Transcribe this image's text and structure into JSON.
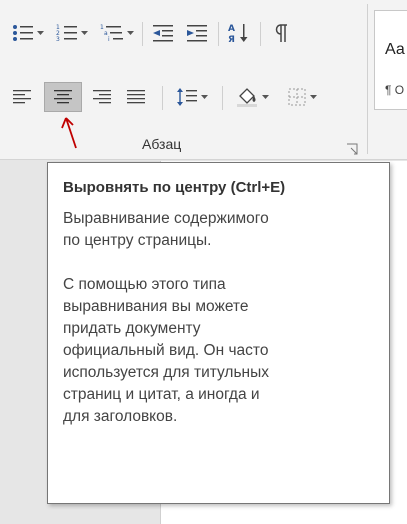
{
  "ribbon": {
    "group_label": "Абзац",
    "styles_sample_text": "Аа",
    "styles_name_text": "¶ О"
  },
  "tooltip": {
    "title": "Выровнять по центру (Ctrl+E)",
    "description_lines": [
      "Выравнивание содержимого",
      "по центру страницы."
    ],
    "details_lines": [
      "С помощью этого типа",
      "выравнивания вы можете",
      "придать документу",
      "официальный вид. Он часто",
      "используется для титульных",
      "страниц и цитат, а иногда и",
      "для заголовков."
    ]
  },
  "colors": {
    "accent_blue": "#2b579a",
    "annotation_red": "#c00000",
    "tooltip_border": "#767676"
  },
  "icons": {
    "bullets": "bullets-list-icon",
    "numbering": "numbered-list-icon",
    "multilevel": "multilevel-list-icon",
    "decrease_indent": "decrease-indent-icon",
    "increase_indent": "increase-indent-icon",
    "sort": "sort-icon",
    "show_marks": "pilcrow-icon",
    "align_left": "align-left-icon",
    "align_center": "align-center-icon",
    "align_right": "align-right-icon",
    "justify": "justify-icon",
    "line_spacing": "line-spacing-icon",
    "shading": "shading-icon",
    "borders": "borders-icon",
    "launcher": "dialog-launcher-icon",
    "annotation": "red-arrow-icon"
  }
}
